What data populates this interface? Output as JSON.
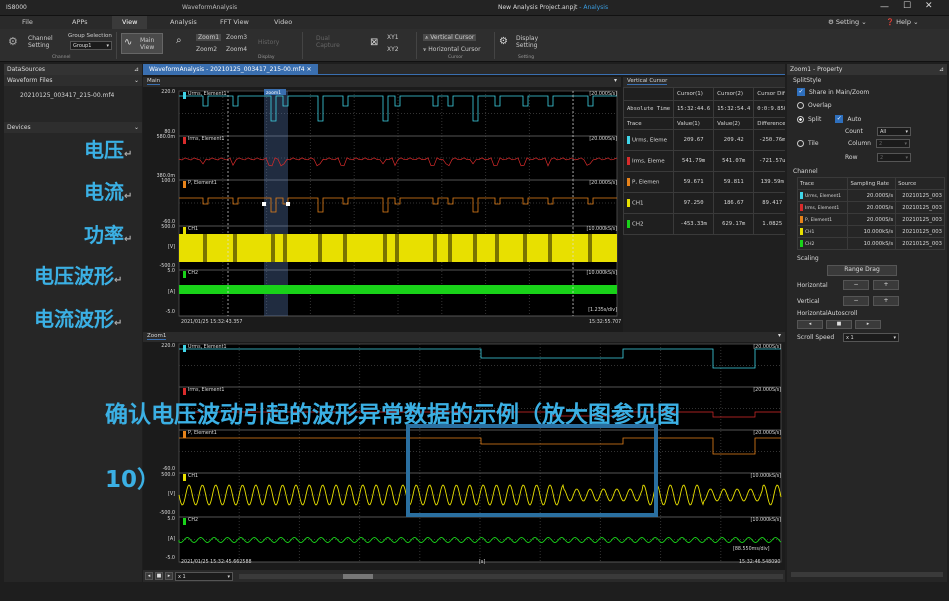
{
  "app": {
    "name": "IS8000",
    "module": "WaveformAnalysis",
    "project_title": "New Analysis Project.anpjt",
    "project_mode": "- Analysis",
    "setting_label": "Setting",
    "help_label": "Help"
  },
  "menu": [
    "File",
    "APPs",
    "View",
    "Analysis",
    "FFT View",
    "Video"
  ],
  "ribbon": {
    "channel_setting": "Channel\nSetting",
    "group_selection": "Group Selection",
    "group_value": "Group1",
    "channel_group": "Channel",
    "main_view": "Main\nView",
    "zoom1": "Zoom1",
    "zoom2": "Zoom2",
    "zoom3": "Zoom3",
    "zoom4": "Zoom4",
    "history": "History",
    "display_group": "Display",
    "dual_capture": "Dual\nCapture",
    "xy1": "XY1",
    "xy2": "XY2",
    "vertical_cursor": "Vertical Cursor",
    "horizontal_cursor": "Horizontal Cursor",
    "cursor_group": "Cursor",
    "display_setting": "Display\nSetting",
    "setting_group": "Setting"
  },
  "left": {
    "datasources": "DataSources",
    "waveform_files": "Waveform Files",
    "file": "20210125_003417_215-00.mf4",
    "devices": "Devices"
  },
  "doc_tab": "WaveformAnalysis - 20210125_003417_215-00.mf4",
  "main_plot": {
    "title": "Main",
    "zoom_tag": "zoom1",
    "traces": [
      {
        "name": "Urms, Element1",
        "color": "#3fd5e8",
        "rate": "[20.000S/s]",
        "top": "220.0",
        "bottom": "80.0"
      },
      {
        "name": "Irms, Element1",
        "color": "#d92b2b",
        "rate": "[20.000S/s]",
        "top": "580.0m",
        "bottom": "380.0m"
      },
      {
        "name": "P, Element1",
        "color": "#e8831a",
        "rate": "[20.000S/s]",
        "top": "100.0",
        "bottom": "-60.0"
      },
      {
        "name": "CH1",
        "color": "#e8e000",
        "rate": "[10.000kS/s]",
        "top": "500.0",
        "bottom": "-500.0",
        "unit": "[V]"
      },
      {
        "name": "CH2",
        "color": "#19d219",
        "rate": "[10.000kS/s]",
        "top": "5.0",
        "bottom": "-5.0",
        "unit": "[A]"
      }
    ],
    "time_start": "2021/01/25 15:32:43.357",
    "time_end": "15:32:55.707",
    "time_div": "[1.235s/div]"
  },
  "zoom_plot": {
    "title": "Zoom1",
    "traces": [
      {
        "name": "Urms, Element1",
        "color": "#3fd5e8",
        "rate": "[20.000S/s]",
        "top": "220.0"
      },
      {
        "name": "Irms, Element1",
        "color": "#d92b2b",
        "rate": "[20.000S/s]"
      },
      {
        "name": "P, Element1",
        "color": "#e8831a",
        "rate": "[20.000S/s]",
        "bottom": "-60.0"
      },
      {
        "name": "CH1",
        "color": "#e8e000",
        "rate": "[10.000kS/s]",
        "top": "500.0",
        "bottom": "-500.0",
        "unit": "[V]"
      },
      {
        "name": "CH2",
        "color": "#19d219",
        "rate": "[10.000kS/s]",
        "top": "5.0",
        "bottom": "-5.0",
        "unit": "[A]"
      }
    ],
    "time_start": "2021/01/25 15:32:45.662588",
    "time_mid": "[s]",
    "time_end": "15:32:46.548090",
    "time_div": "[88.550ms/div]",
    "zoom_value": "x 1"
  },
  "cursor": {
    "title": "Vertical Cursor",
    "headers": [
      "",
      "Cursor(1)",
      "Cursor(2)",
      "Cursor Diff"
    ],
    "abs_row": [
      "Absolute Time",
      "15:32:44.6",
      "15:32:54.4",
      "0:0:9.850"
    ],
    "trace_headers": [
      "Trace",
      "Value(1)",
      "Value(2)",
      "Difference"
    ],
    "rows": [
      {
        "name": "Urms, Eleme",
        "color": "#3fd5e8",
        "v1": "209.67",
        "v2": "209.42",
        "d": "-250.76m"
      },
      {
        "name": "Irms, Eleme",
        "color": "#d92b2b",
        "v1": "541.79m",
        "v2": "541.07m",
        "d": "-721.57u"
      },
      {
        "name": "P, Elemen",
        "color": "#e8831a",
        "v1": "59.671",
        "v2": "59.811",
        "d": "139.59m"
      },
      {
        "name": "CH1",
        "color": "#e8e000",
        "v1": "97.250",
        "v2": "186.67",
        "d": "89.417"
      },
      {
        "name": "CH2",
        "color": "#19d219",
        "v1": "-453.33m",
        "v2": "629.17m",
        "d": "1.0825"
      }
    ]
  },
  "property": {
    "title": "Zoom1 - Property",
    "split_style": "SplitStyle",
    "share": "Share in Main/Zoom",
    "overlap": "Overlap",
    "split": "Split",
    "auto": "Auto",
    "count": "Count",
    "count_value": "All",
    "tile": "Tile",
    "column": "Column",
    "column_value": "2",
    "row": "Row",
    "row_value": "2",
    "channel": "Channel",
    "ch_headers": [
      "Trace",
      "Sampling Rate",
      "Source"
    ],
    "ch_rows": [
      {
        "name": "Urms, Element1",
        "color": "#3fd5e8",
        "rate": "20.000S/s",
        "src": "20210125_003"
      },
      {
        "name": "Irms, Element1",
        "color": "#d92b2b",
        "rate": "20.000S/s",
        "src": "20210125_003"
      },
      {
        "name": "P, Element1",
        "color": "#e8831a",
        "rate": "20.000S/s",
        "src": "20210125_003"
      },
      {
        "name": "CH1",
        "color": "#e8e000",
        "rate": "10.000kS/s",
        "src": "20210125_003"
      },
      {
        "name": "CH2",
        "color": "#19d219",
        "rate": "10.000kS/s",
        "src": "20210125_003"
      }
    ],
    "scaling": "Scaling",
    "range_drag": "Range Drag",
    "horizontal": "Horizontal",
    "vertical": "Vertical",
    "minus": "−",
    "plus": "+",
    "autoscroll": "HorizontalAutoscroll",
    "scroll_speed": "Scroll Speed",
    "scroll_value": "x 1"
  },
  "annotations": {
    "voltage": "电压",
    "current": "电流",
    "power": "功率",
    "voltage_wave": "电压波形",
    "current_wave": "电流波形",
    "caption_line1": "确认电压波动引起的波形异常数据的示例（放大图参见图",
    "caption_line2": "10）"
  }
}
